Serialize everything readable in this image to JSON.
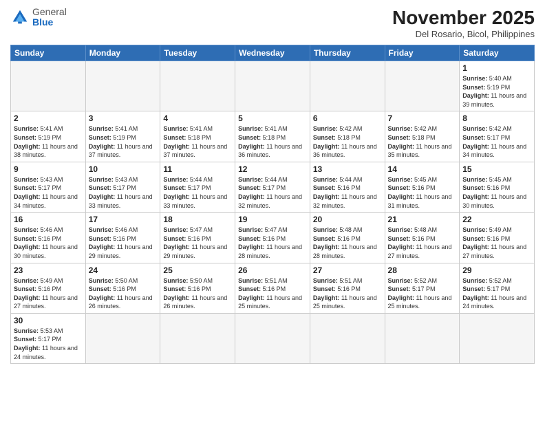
{
  "logo": {
    "general": "General",
    "blue": "Blue"
  },
  "title": "November 2025",
  "subtitle": "Del Rosario, Bicol, Philippines",
  "weekdays": [
    "Sunday",
    "Monday",
    "Tuesday",
    "Wednesday",
    "Thursday",
    "Friday",
    "Saturday"
  ],
  "days": [
    {
      "num": "",
      "empty": true
    },
    {
      "num": "",
      "empty": true
    },
    {
      "num": "",
      "empty": true
    },
    {
      "num": "",
      "empty": true
    },
    {
      "num": "",
      "empty": true
    },
    {
      "num": "",
      "empty": true
    },
    {
      "num": "1",
      "sunrise": "5:40 AM",
      "sunset": "5:19 PM",
      "daylight": "11 hours and 39 minutes."
    },
    {
      "num": "2",
      "sunrise": "5:41 AM",
      "sunset": "5:19 PM",
      "daylight": "11 hours and 38 minutes."
    },
    {
      "num": "3",
      "sunrise": "5:41 AM",
      "sunset": "5:19 PM",
      "daylight": "11 hours and 37 minutes."
    },
    {
      "num": "4",
      "sunrise": "5:41 AM",
      "sunset": "5:18 PM",
      "daylight": "11 hours and 37 minutes."
    },
    {
      "num": "5",
      "sunrise": "5:41 AM",
      "sunset": "5:18 PM",
      "daylight": "11 hours and 36 minutes."
    },
    {
      "num": "6",
      "sunrise": "5:42 AM",
      "sunset": "5:18 PM",
      "daylight": "11 hours and 36 minutes."
    },
    {
      "num": "7",
      "sunrise": "5:42 AM",
      "sunset": "5:18 PM",
      "daylight": "11 hours and 35 minutes."
    },
    {
      "num": "8",
      "sunrise": "5:42 AM",
      "sunset": "5:17 PM",
      "daylight": "11 hours and 34 minutes."
    },
    {
      "num": "9",
      "sunrise": "5:43 AM",
      "sunset": "5:17 PM",
      "daylight": "11 hours and 34 minutes."
    },
    {
      "num": "10",
      "sunrise": "5:43 AM",
      "sunset": "5:17 PM",
      "daylight": "11 hours and 33 minutes."
    },
    {
      "num": "11",
      "sunrise": "5:44 AM",
      "sunset": "5:17 PM",
      "daylight": "11 hours and 33 minutes."
    },
    {
      "num": "12",
      "sunrise": "5:44 AM",
      "sunset": "5:17 PM",
      "daylight": "11 hours and 32 minutes."
    },
    {
      "num": "13",
      "sunrise": "5:44 AM",
      "sunset": "5:16 PM",
      "daylight": "11 hours and 32 minutes."
    },
    {
      "num": "14",
      "sunrise": "5:45 AM",
      "sunset": "5:16 PM",
      "daylight": "11 hours and 31 minutes."
    },
    {
      "num": "15",
      "sunrise": "5:45 AM",
      "sunset": "5:16 PM",
      "daylight": "11 hours and 30 minutes."
    },
    {
      "num": "16",
      "sunrise": "5:46 AM",
      "sunset": "5:16 PM",
      "daylight": "11 hours and 30 minutes."
    },
    {
      "num": "17",
      "sunrise": "5:46 AM",
      "sunset": "5:16 PM",
      "daylight": "11 hours and 29 minutes."
    },
    {
      "num": "18",
      "sunrise": "5:47 AM",
      "sunset": "5:16 PM",
      "daylight": "11 hours and 29 minutes."
    },
    {
      "num": "19",
      "sunrise": "5:47 AM",
      "sunset": "5:16 PM",
      "daylight": "11 hours and 28 minutes."
    },
    {
      "num": "20",
      "sunrise": "5:48 AM",
      "sunset": "5:16 PM",
      "daylight": "11 hours and 28 minutes."
    },
    {
      "num": "21",
      "sunrise": "5:48 AM",
      "sunset": "5:16 PM",
      "daylight": "11 hours and 27 minutes."
    },
    {
      "num": "22",
      "sunrise": "5:49 AM",
      "sunset": "5:16 PM",
      "daylight": "11 hours and 27 minutes."
    },
    {
      "num": "23",
      "sunrise": "5:49 AM",
      "sunset": "5:16 PM",
      "daylight": "11 hours and 27 minutes."
    },
    {
      "num": "24",
      "sunrise": "5:50 AM",
      "sunset": "5:16 PM",
      "daylight": "11 hours and 26 minutes."
    },
    {
      "num": "25",
      "sunrise": "5:50 AM",
      "sunset": "5:16 PM",
      "daylight": "11 hours and 26 minutes."
    },
    {
      "num": "26",
      "sunrise": "5:51 AM",
      "sunset": "5:16 PM",
      "daylight": "11 hours and 25 minutes."
    },
    {
      "num": "27",
      "sunrise": "5:51 AM",
      "sunset": "5:16 PM",
      "daylight": "11 hours and 25 minutes."
    },
    {
      "num": "28",
      "sunrise": "5:52 AM",
      "sunset": "5:17 PM",
      "daylight": "11 hours and 25 minutes."
    },
    {
      "num": "29",
      "sunrise": "5:52 AM",
      "sunset": "5:17 PM",
      "daylight": "11 hours and 24 minutes."
    },
    {
      "num": "30",
      "sunrise": "5:53 AM",
      "sunset": "5:17 PM",
      "daylight": "11 hours and 24 minutes."
    }
  ],
  "labels": {
    "sunrise": "Sunrise:",
    "sunset": "Sunset:",
    "daylight": "Daylight:"
  }
}
